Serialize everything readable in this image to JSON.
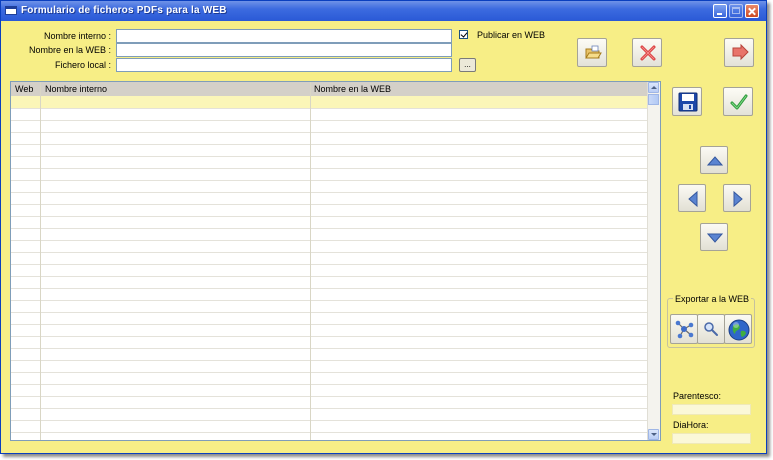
{
  "window": {
    "title": "Formulario de ficheros PDFs para la WEB"
  },
  "form": {
    "nombre_interno_label": "Nombre interno :",
    "nombre_interno_value": "",
    "nombre_web_label": "Nombre en la WEB :",
    "nombre_web_value": "",
    "fichero_local_label": "Fichero local :",
    "fichero_local_value": "",
    "publicar_label": "Publicar en WEB",
    "publicar_checked": true,
    "browse_label": "..."
  },
  "toolbar": {
    "icons": [
      "open-folder-icon",
      "delete-x-icon",
      "exit-arrow-icon",
      "save-disk-icon",
      "accept-check-icon"
    ]
  },
  "grid": {
    "columns": [
      "Web",
      "Nombre interno",
      "Nombre en la WEB"
    ],
    "rows": []
  },
  "navigation": {
    "icons": [
      "arrow-up-icon",
      "arrow-left-icon",
      "arrow-right-icon",
      "arrow-down-icon"
    ]
  },
  "export": {
    "title": "Exportar a la WEB",
    "icons": [
      "network-icon",
      "search-icon",
      "globe-icon"
    ]
  },
  "info": {
    "parentesco_label": "Parentesco:",
    "parentesco_value": "",
    "diahora_label": "DiaHora:",
    "diahora_value": ""
  },
  "colors": {
    "window_bg": "#f7ee86",
    "title_bar": "#2a59d6",
    "grid_header": "#d4d0c8",
    "selected_row": "#fbf6b8"
  }
}
